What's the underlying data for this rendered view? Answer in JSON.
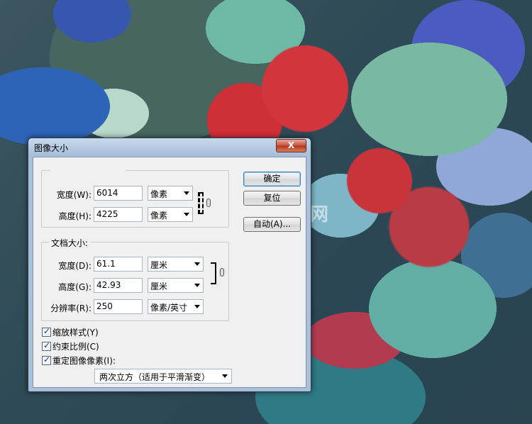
{
  "dialog": {
    "title": "图像大小",
    "close_label": "X"
  },
  "pixel_dimensions": {
    "width_label": "宽度(W):",
    "width_value": "6014",
    "width_unit": "像素",
    "height_label": "高度(H):",
    "height_value": "4225",
    "height_unit": "像素"
  },
  "document_size": {
    "legend": "文档大小:",
    "width_label": "宽度(D):",
    "width_value": "61.1",
    "width_unit": "厘米",
    "height_label": "高度(G):",
    "height_value": "42.93",
    "height_unit": "厘米",
    "resolution_label": "分辨率(R):",
    "resolution_value": "250",
    "resolution_unit": "像素/英寸"
  },
  "buttons": {
    "ok": "确定",
    "reset": "复位",
    "auto": "自动(A)..."
  },
  "options": {
    "scale_styles": {
      "label": "缩放样式(Y)",
      "checked": true
    },
    "constrain_proportions": {
      "label": "约束比例(C)",
      "checked": true
    },
    "resample": {
      "label": "重定图像像素(I):",
      "checked": true
    },
    "resample_method": "两次立方（适用于平滑渐变）"
  },
  "watermark": {
    "text": "九奇艺术网"
  },
  "colors": {
    "titlebar": "#a9c0d8",
    "client": "#f0f0f0",
    "close": "#c8503a"
  }
}
